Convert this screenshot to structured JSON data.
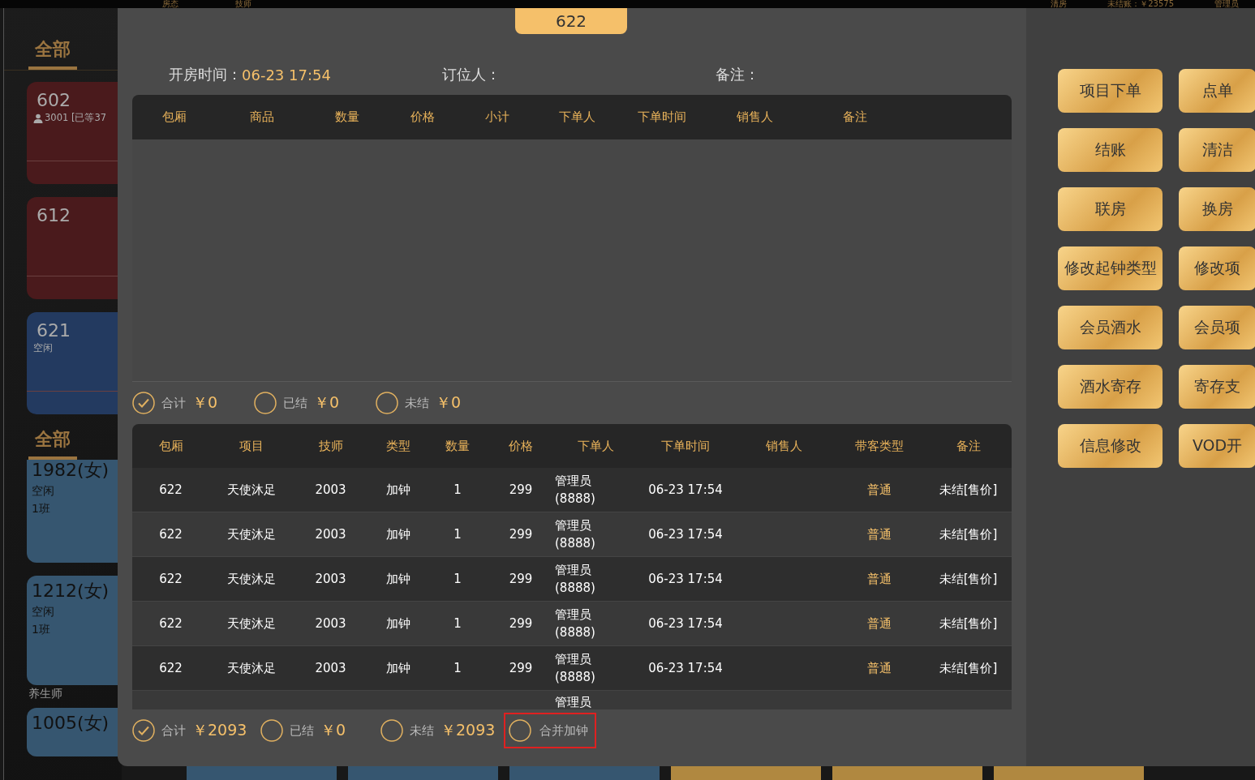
{
  "top_bar": {
    "tabs": [
      "房态",
      "技师"
    ],
    "right": [
      "清房",
      "未结账：￥23575",
      "管理员"
    ]
  },
  "room_panel": {
    "tab": {
      "label": "全部",
      "selected": true
    },
    "rooms": [
      {
        "number": "602",
        "detail": "3001 [已等37",
        "has_person": true,
        "color": "#4a1a1c"
      },
      {
        "number": "612",
        "has_person": false,
        "color": "#4a1a1c"
      },
      {
        "number": "621",
        "detail": "空闲",
        "has_person": false,
        "color": "#233a60"
      }
    ]
  },
  "therapist_panel": {
    "tab": {
      "label": "全部",
      "selected": true
    },
    "therapists": [
      {
        "name": "1982(女)",
        "status": "空闲",
        "shift": "1班"
      },
      {
        "name": "1212(女)",
        "status": "空闲",
        "shift": "1班"
      }
    ],
    "group_label": "养生师",
    "next": "1005(女)"
  },
  "dialog": {
    "room_tab": "622",
    "info": [
      {
        "label": "开房时间：",
        "value": "06-23 17:54"
      },
      {
        "label": "订位人："
      },
      {
        "label": "备注："
      }
    ],
    "goods_table": {
      "columns": [
        "包厢",
        "商品",
        "数量",
        "价格",
        "小计",
        "下单人",
        "下单时间",
        "销售人",
        "备注"
      ]
    },
    "goods_totals": [
      {
        "label": "合计",
        "amount": "￥0",
        "checked": true
      },
      {
        "label": "已结",
        "amount": "￥0",
        "checked": false
      },
      {
        "label": "未结",
        "amount": "￥0",
        "checked": false
      }
    ],
    "items_table": {
      "columns": [
        "包厢",
        "项目",
        "技师",
        "类型",
        "数量",
        "价格",
        "下单人",
        "下单时间",
        "销售人",
        "带客类型",
        "备注"
      ],
      "rows": [
        [
          "622",
          "天使沐足",
          "2003",
          "加钟",
          "1",
          "299",
          "管理员\n(8888)",
          "06-23 17:54",
          "",
          "普通",
          "未结[售价]"
        ],
        [
          "622",
          "天使沐足",
          "2003",
          "加钟",
          "1",
          "299",
          "管理员\n(8888)",
          "06-23 17:54",
          "",
          "普通",
          "未结[售价]"
        ],
        [
          "622",
          "天使沐足",
          "2003",
          "加钟",
          "1",
          "299",
          "管理员\n(8888)",
          "06-23 17:54",
          "",
          "普通",
          "未结[售价]"
        ],
        [
          "622",
          "天使沐足",
          "2003",
          "加钟",
          "1",
          "299",
          "管理员\n(8888)",
          "06-23 17:54",
          "",
          "普通",
          "未结[售价]"
        ],
        [
          "622",
          "天使沐足",
          "2003",
          "加钟",
          "1",
          "299",
          "管理员\n(8888)",
          "06-23 17:54",
          "",
          "普通",
          "未结[售价]"
        ],
        [
          "",
          "",
          "",
          "",
          "",
          "",
          "管理员",
          "",
          "",
          "",
          ""
        ]
      ]
    },
    "items_totals": [
      {
        "label": "合计",
        "amount": "￥2093",
        "checked": true
      },
      {
        "label": "已结",
        "amount": "￥0",
        "checked": false
      },
      {
        "label": "未结",
        "amount": "￥2093",
        "checked": false
      },
      {
        "label": "合并加钟",
        "checked": false,
        "highlighted": true
      }
    ],
    "actions": [
      [
        "项目下单",
        "点单"
      ],
      [
        "结账",
        "清洁"
      ],
      [
        "联房",
        "换房"
      ],
      [
        "修改起钟类型",
        "修改项"
      ],
      [
        "会员酒水",
        "会员项"
      ],
      [
        "酒水寄存",
        "寄存支"
      ],
      [
        "信息修改",
        "VOD开"
      ]
    ]
  }
}
